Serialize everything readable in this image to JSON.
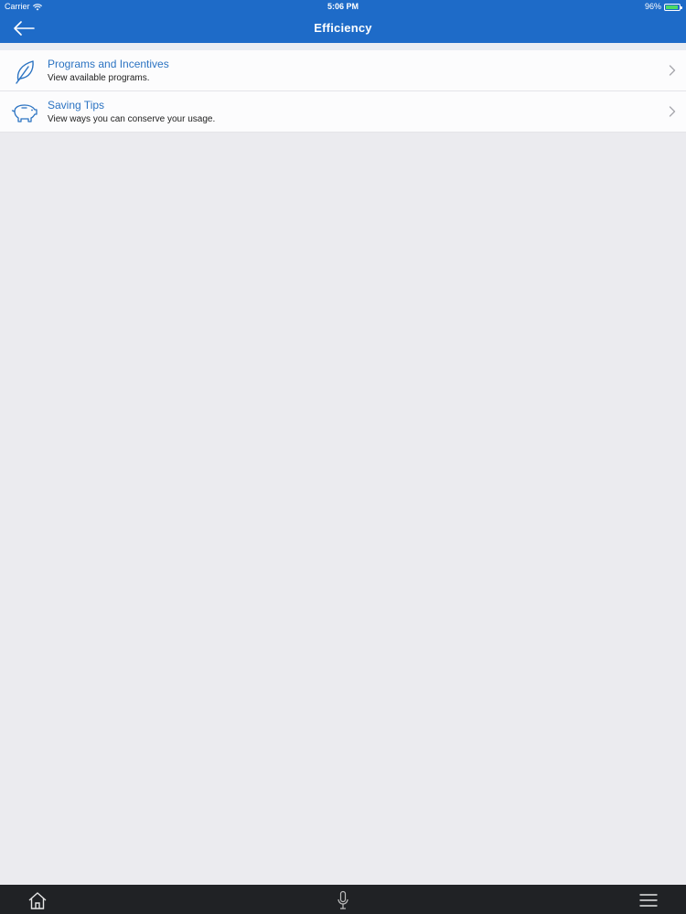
{
  "status_bar": {
    "carrier": "Carrier",
    "time": "5:06 PM",
    "battery": "96%",
    "wifi_icon": "wifi-icon",
    "battery_level": 0.96
  },
  "nav": {
    "title": "Efficiency",
    "back_icon": "arrow-left-icon"
  },
  "list": [
    {
      "title": "Programs and Incentives",
      "subtitle": "View available programs.",
      "icon": "leaf-icon"
    },
    {
      "title": "Saving Tips",
      "subtitle": "View ways you can conserve your usage.",
      "icon": "piggy-bank-icon"
    }
  ],
  "bottom_bar": {
    "items": [
      "home-icon",
      "microphone-icon",
      "menu-icon"
    ]
  },
  "colors": {
    "header": "#1e6bc8",
    "link": "#2b73c2",
    "background": "#ebebef",
    "bottom_bar": "#202225"
  }
}
